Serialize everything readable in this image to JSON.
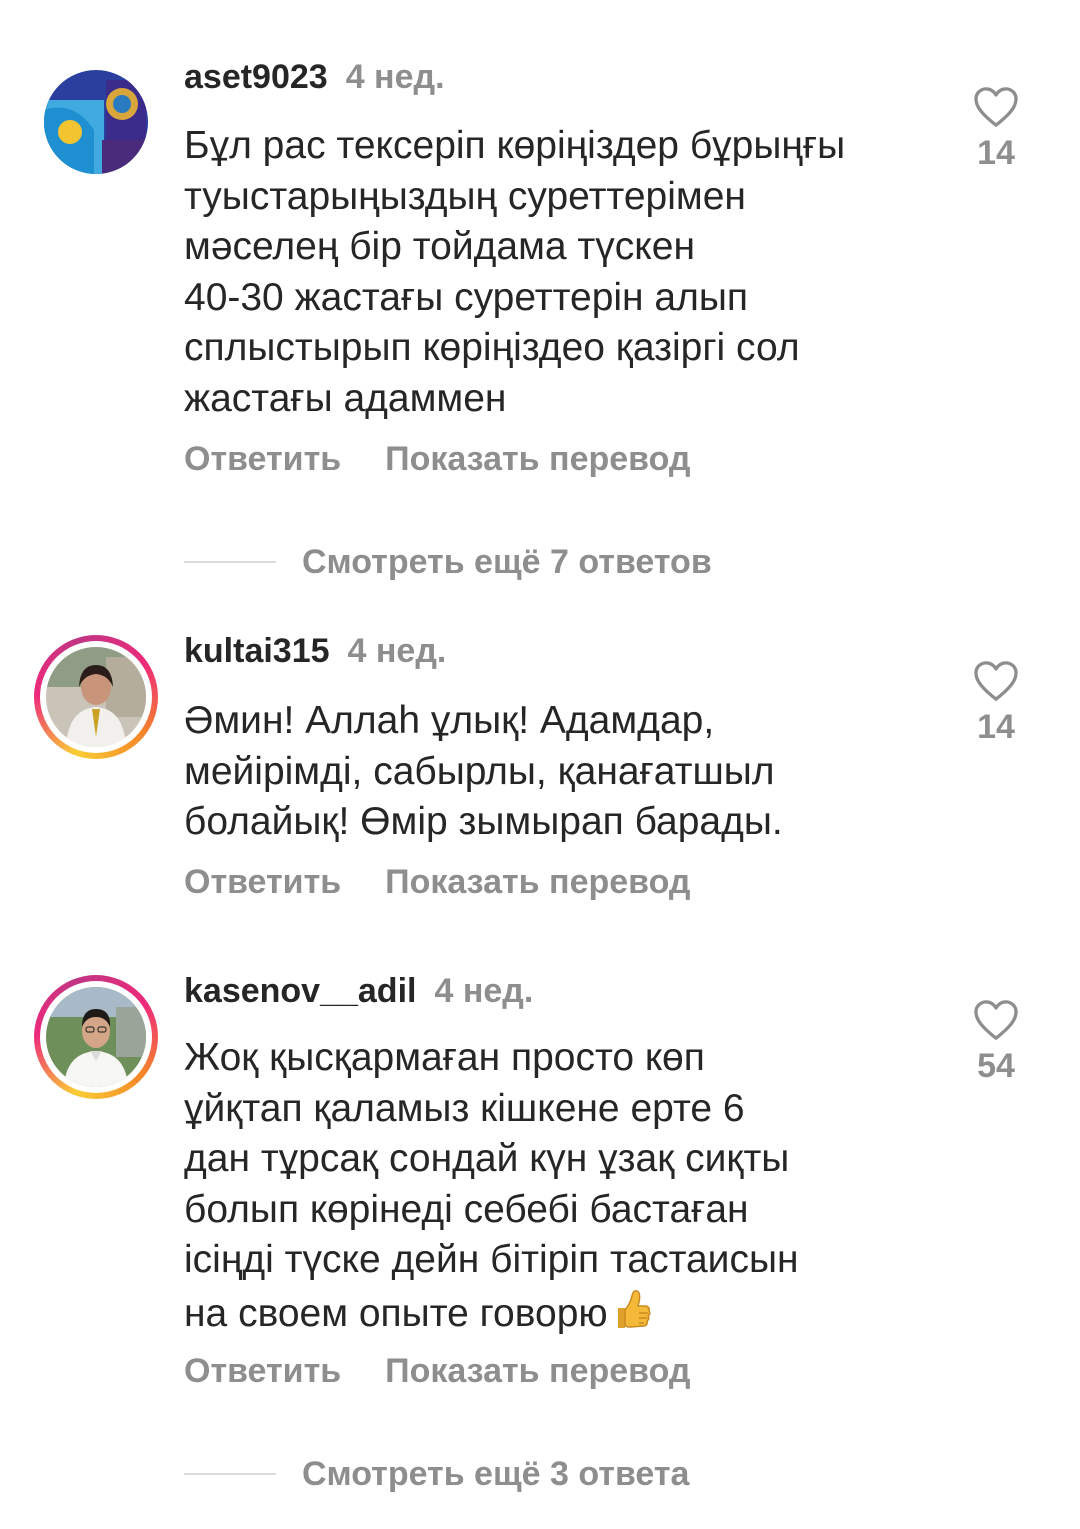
{
  "comments": [
    {
      "username": "aset9023",
      "time": "4 нед.",
      "lines": [
        "Бұл рас тексеріп көріңіздер бұрыңғы",
        "туыстарыңыздың  суреттерімен",
        "мәселең бір тойдама түскен",
        "40-30 жастағы суреттерін алып",
        "сплыстырып көріңіздео қазіргі сол",
        "жастағы адаммен"
      ],
      "likes": "14",
      "reply_label": "Ответить",
      "translate_label": "Показать перевод",
      "more_replies": "Смотреть ещё 7 ответов"
    },
    {
      "username": "kultai315",
      "time": "4 нед.",
      "lines": [
        "Әмин! Аллаһ ұлық! Адамдар,",
        "мейірімді, сабырлы,  қанағатшыл",
        "болайық!  Өмір зымырап барады."
      ],
      "likes": "14",
      "reply_label": "Ответить",
      "translate_label": "Показать перевод"
    },
    {
      "username": "kasenov__adil",
      "time": "4 нед.",
      "lines": [
        "Жоқ қысқармаған просто көп",
        "ұйқтап қаламыз кішкене ерте 6",
        "дан тұрсақ сондай күн ұзақ сиқты",
        "болып көрінеді себебі бастаған",
        "ісіңді түске дейн бітіріп тастаисын",
        "на своем опыте говорю"
      ],
      "likes": "54",
      "reply_label": "Ответить",
      "translate_label": "Показать перевод",
      "more_replies": "Смотреть ещё 3 ответа"
    }
  ],
  "icons": {
    "like": "heart-outline-icon",
    "emoji": "thumbs-up-icon"
  },
  "colors": {
    "text": "#262626",
    "secondary": "#8e8e8e",
    "divider": "#dbdbdb"
  }
}
